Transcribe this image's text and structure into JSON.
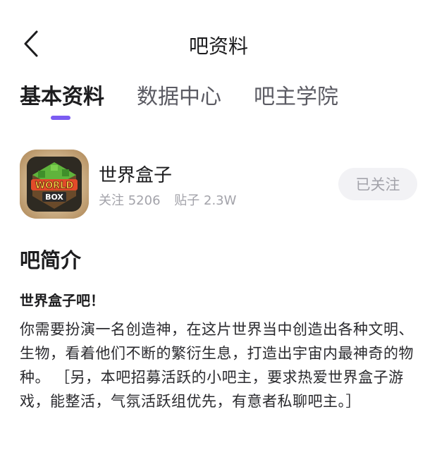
{
  "header": {
    "back_icon": "chevron-left-icon",
    "title": "吧资料"
  },
  "tabs": [
    {
      "label": "基本资料",
      "active": true
    },
    {
      "label": "数据中心",
      "active": false
    },
    {
      "label": "吧主学院",
      "active": false
    }
  ],
  "accent_color": "#7b5cf2",
  "forum": {
    "logo_text_line1": "WORLD",
    "logo_text_line2": "BOX",
    "name": "世界盒子",
    "followers_label": "关注 5206",
    "posts_label": "贴子 2.3W",
    "follow_button": "已关注"
  },
  "intro": {
    "heading": "吧简介",
    "subtitle": "世界盒子吧！",
    "body": "你需要扮演一名创造神，在这片世界当中创造出各种文明、生物，看着他们不断的繁衍生息，打造出宇宙内最神奇的物种。 ［另，本吧招募活跃的小吧主，要求热爱世界盒子游戏，能整活，气氛活跃组优先，有意者私聊吧主。］"
  }
}
